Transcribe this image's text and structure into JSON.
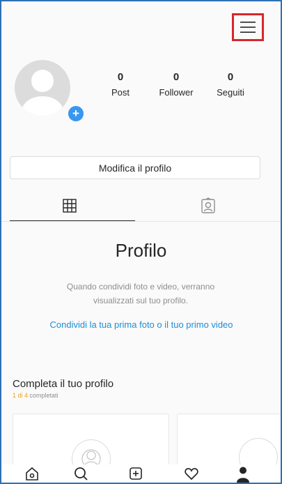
{
  "header": {
    "menu_icon": "hamburger-icon",
    "highlight_color": "#d9262c"
  },
  "profile": {
    "avatar_icon": "avatar-placeholder-icon",
    "add_photo_icon": "plus-icon",
    "add_photo_symbol": "+",
    "stats": [
      {
        "value": "0",
        "label": "Post"
      },
      {
        "value": "0",
        "label": "Follower"
      },
      {
        "value": "0",
        "label": "Seguiti"
      }
    ],
    "edit_label": "Modifica il profilo"
  },
  "tabs": [
    {
      "icon": "grid-icon",
      "active": true
    },
    {
      "icon": "tagged-icon",
      "active": false
    }
  ],
  "empty_state": {
    "title": "Profilo",
    "description": "Quando condividi foto e video, verranno visualizzati sul tuo profilo.",
    "link": "Condividi la tua prima foto o il tuo primo video"
  },
  "complete_profile": {
    "title": "Completa il tuo profilo",
    "progress_highlight": "1 di 4",
    "progress_rest": " completati",
    "progress_fraction": 0.25
  },
  "bottom_nav": [
    {
      "icon": "home-icon"
    },
    {
      "icon": "search-icon"
    },
    {
      "icon": "add-post-icon"
    },
    {
      "icon": "heart-icon"
    },
    {
      "icon": "profile-icon",
      "active": true
    }
  ],
  "colors": {
    "link": "#1a8fd6",
    "accent": "#3897f0",
    "progress": "#f0a020",
    "frame": "#2f6fb3"
  }
}
